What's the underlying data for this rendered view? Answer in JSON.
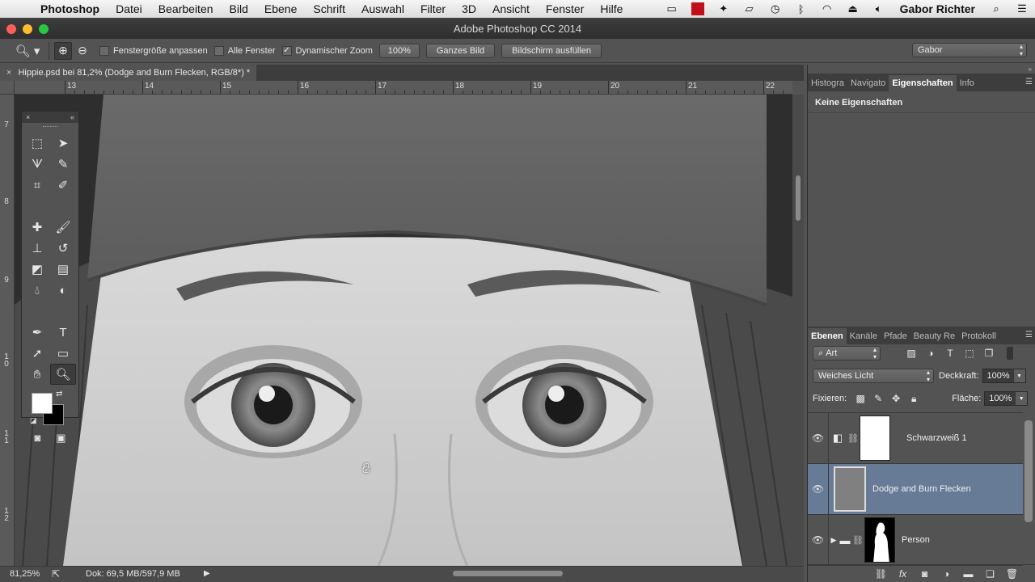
{
  "menubar": {
    "apple": "",
    "app": "Photoshop",
    "items": [
      "Datei",
      "Bearbeiten",
      "Bild",
      "Ebene",
      "Schrift",
      "Auswahl",
      "Filter",
      "3D",
      "Ansicht",
      "Fenster",
      "Hilfe"
    ],
    "user": "Gabor Richter"
  },
  "window": {
    "title": "Adobe Photoshop CC 2014"
  },
  "options": {
    "resize_windows": "Fenstergröße anpassen",
    "all_windows": "Alle Fenster",
    "scrubby_zoom": "Dynamischer Zoom",
    "scrubby_checked": true,
    "pct_button": "100%",
    "fit_screen": "Ganzes Bild",
    "fill_screen": "Bildschirm ausfüllen",
    "workspace": "Gabor"
  },
  "document": {
    "tab_title": "Hippie.psd bei 81,2% (Dodge and Burn Flecken, RGB/8*) *"
  },
  "rulers": {
    "horizontal": [
      "13",
      "14",
      "15",
      "16",
      "17",
      "18",
      "19",
      "20",
      "21",
      "22"
    ],
    "vertical": [
      "7",
      "8",
      "9",
      "1\n0",
      "1\n1",
      "1\n2"
    ]
  },
  "status": {
    "zoom": "81,25%",
    "doc": "Dok: 69,5 MB/597,9 MB"
  },
  "properties_panel": {
    "tabs": [
      "Histogra",
      "Navigato",
      "Eigenschaften",
      "Info"
    ],
    "active_tab": 2,
    "content": "Keine Eigenschaften"
  },
  "layers_panel": {
    "tabs": [
      "Ebenen",
      "Kanäle",
      "Pfade",
      "Beauty Re",
      "Protokoll"
    ],
    "active_tab": 0,
    "filter_kind": "Art",
    "blend_mode": "Weiches Licht",
    "opacity_label": "Deckkraft:",
    "opacity": "100%",
    "lock_label": "Fixieren:",
    "fill_label": "Fläche:",
    "fill": "100%",
    "layers": [
      {
        "name": "Schwarzweiß 1",
        "selected": false,
        "thumb_color": "#ffffff",
        "adjustment": true
      },
      {
        "name": "Dodge and Burn Flecken",
        "selected": true,
        "thumb_color": "#808080",
        "adjustment": false
      },
      {
        "name": "Person",
        "selected": false,
        "thumb_color": "#000000",
        "group": true
      }
    ]
  },
  "colors": {
    "foreground": "#ffffff",
    "background": "#000000",
    "selected_layer": "#677a96"
  }
}
